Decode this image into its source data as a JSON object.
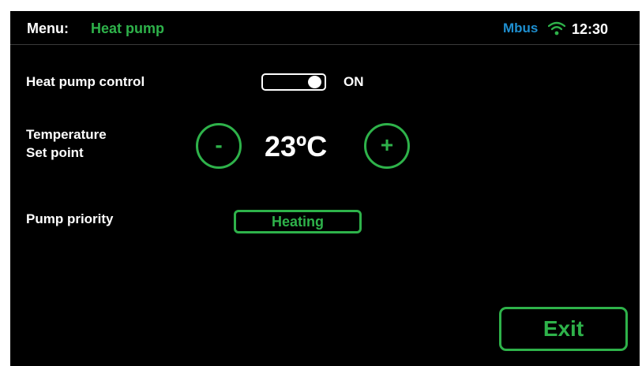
{
  "header": {
    "menu_label": "Menu:",
    "menu_name": "Heat pump",
    "bus_label": "Mbus",
    "wifi_icon": "wifi-icon",
    "time": "12:30"
  },
  "heat_pump_control": {
    "label": "Heat pump control",
    "state": "ON",
    "is_on": true
  },
  "temperature": {
    "label_line1": "Temperature",
    "label_line2": "Set point",
    "decrement_label": "-",
    "increment_label": "+",
    "value": "23ºC"
  },
  "pump_priority": {
    "label": "Pump priority",
    "value": "Heating"
  },
  "exit_label": "Exit",
  "colors": {
    "background": "#000000",
    "accent_green": "#2eb24a",
    "bus_blue": "#1e8fd0",
    "text": "#ffffff"
  }
}
